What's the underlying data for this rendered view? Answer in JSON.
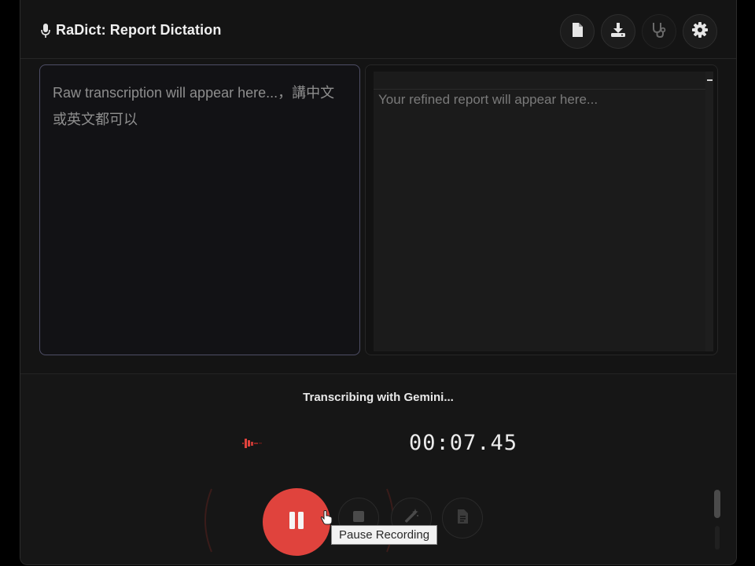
{
  "header": {
    "title": "RaDict: Report Dictation",
    "icons": [
      "microphone-icon",
      "document-icon",
      "download-icon",
      "stethoscope-icon",
      "gear-icon"
    ]
  },
  "raw_panel": {
    "placeholder": "Raw transcription will appear here...，講中文或英文都可以"
  },
  "refined_panel": {
    "placeholder": "Your refined report will appear here..."
  },
  "recorder": {
    "status": "Transcribing with Gemini...",
    "timer": "00:07.45",
    "tooltip": "Pause Recording"
  },
  "colors": {
    "record_red": "#e0433d",
    "background": "#141414",
    "raw_panel_border": "#4e4e66"
  }
}
